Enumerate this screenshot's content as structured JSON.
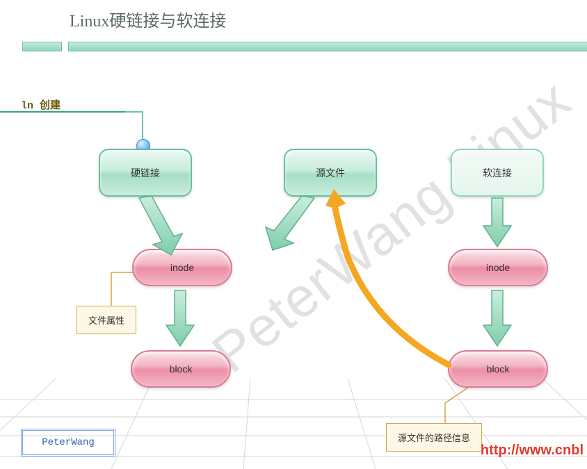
{
  "title": "Linux硬链接与软连接",
  "ln_label": "ln 创建",
  "nodes": {
    "hardlink": "硬链接",
    "sourcefile": "源文件",
    "softlink": "软连接",
    "inode_left": "inode",
    "inode_right": "inode",
    "block_left": "block",
    "block_right": "block"
  },
  "notes": {
    "file_attr": "文件属性",
    "path_info": "源文件的路径信息"
  },
  "footer_author": "PeterWang",
  "watermark": "PeterWang Linux",
  "url_fragment": "http://www.cnbl"
}
